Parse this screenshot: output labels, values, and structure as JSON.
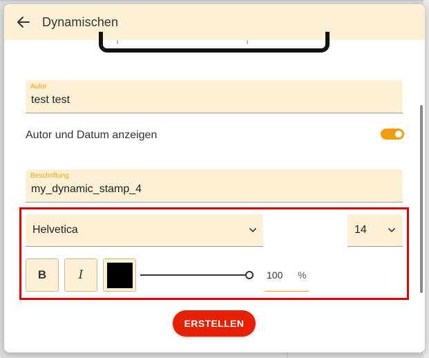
{
  "header": {
    "title": "Dynamischen",
    "back_icon": "arrow-left-icon"
  },
  "form": {
    "author": {
      "label": "Autor",
      "value": "test test"
    },
    "show_author_date": {
      "label": "Autor und Datum anzeigen",
      "enabled": true
    },
    "caption": {
      "label": "Beschriftung",
      "value": "my_dynamic_stamp_4"
    },
    "font": {
      "family": "Helvetica",
      "size": "14"
    },
    "style": {
      "bold_label": "B",
      "italic_label": "I",
      "color": "#000000"
    },
    "opacity": {
      "value": "100",
      "unit": "%",
      "fraction": 1.0
    }
  },
  "actions": {
    "create_label": "ERSTELLEN"
  },
  "colors": {
    "accent": "#f39c12",
    "field_bg": "#fdf0d5",
    "primary_button": "#e62000",
    "highlight": "#e00000"
  }
}
